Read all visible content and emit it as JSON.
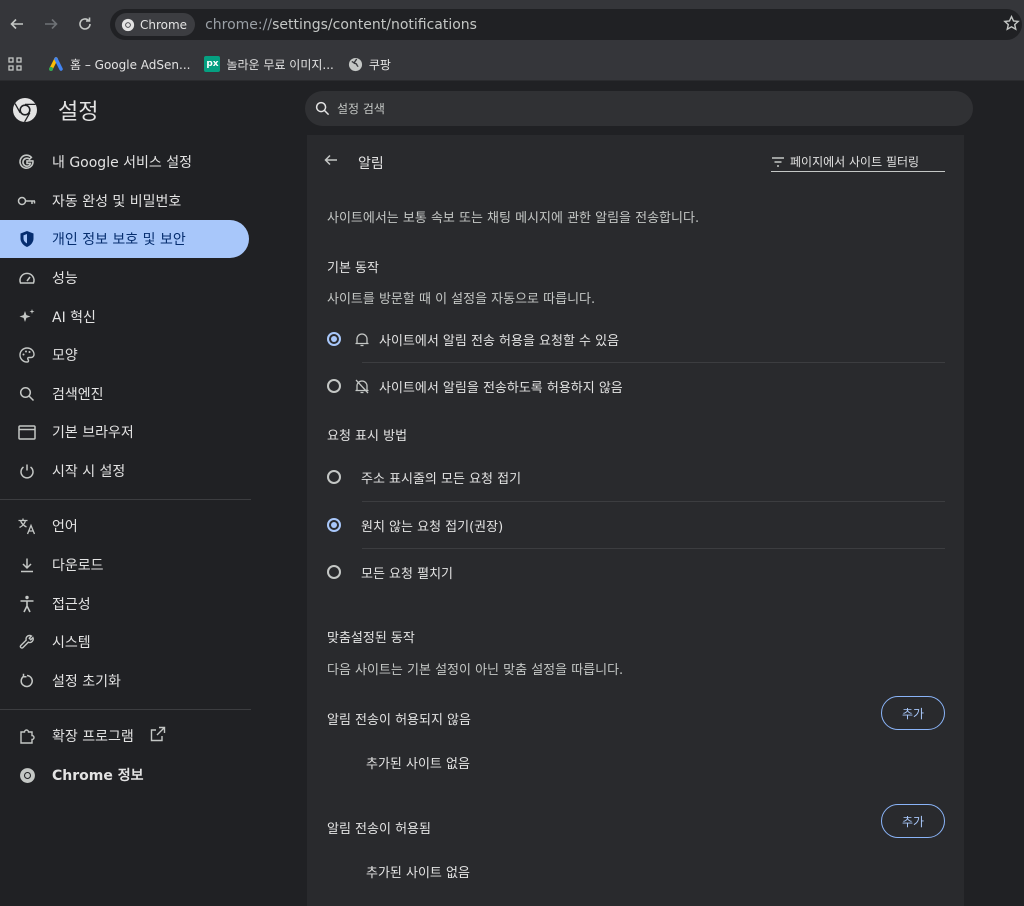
{
  "browser": {
    "chip_label": "Chrome",
    "url_scheme": "chrome://",
    "url_path": "settings/content/notifications"
  },
  "bookmarks": [
    {
      "label": "홈 – Google AdSen..."
    },
    {
      "label": "놀라운 무료 이미지..."
    },
    {
      "label": "쿠팡"
    }
  ],
  "header": {
    "title": "설정",
    "search_placeholder": "설정 검색"
  },
  "sidebar": {
    "items": [
      {
        "label": "내 Google 서비스 설정",
        "icon": "google-g-icon"
      },
      {
        "label": "자동 완성 및 비밀번호",
        "icon": "key-icon"
      },
      {
        "label": "개인 정보 보호 및 보안",
        "icon": "shield-icon",
        "active": true
      },
      {
        "label": "성능",
        "icon": "speedometer-icon"
      },
      {
        "label": "AI 혁신",
        "icon": "sparkle-icon"
      },
      {
        "label": "모양",
        "icon": "palette-icon"
      },
      {
        "label": "검색엔진",
        "icon": "search-icon"
      },
      {
        "label": "기본 브라우저",
        "icon": "browser-window-icon"
      },
      {
        "label": "시작 시 설정",
        "icon": "power-icon"
      },
      {
        "label": "언어",
        "icon": "translate-icon"
      },
      {
        "label": "다운로드",
        "icon": "download-icon"
      },
      {
        "label": "접근성",
        "icon": "accessibility-icon"
      },
      {
        "label": "시스템",
        "icon": "wrench-icon"
      },
      {
        "label": "설정 초기화",
        "icon": "reset-icon"
      },
      {
        "label": "확장 프로그램",
        "icon": "puzzle-icon"
      },
      {
        "label": "Chrome 정보",
        "icon": "chrome-logo-icon"
      }
    ]
  },
  "content": {
    "title": "알림",
    "filter_placeholder": "페이지에서 사이트 필터링",
    "description": "사이트에서는 보통 속보 또는 채팅 메시지에 관한 알림을 전송합니다.",
    "default_behavior": {
      "heading": "기본 동작",
      "sub": "사이트를 방문할 때 이 설정을 자동으로 따릅니다.",
      "options": [
        {
          "label": "사이트에서 알림 전송 허용을 요청할 수 있음",
          "selected": true,
          "icon": "bell-icon"
        },
        {
          "label": "사이트에서 알림을 전송하도록 허용하지 않음",
          "selected": false,
          "icon": "bell-off-icon"
        }
      ]
    },
    "request_display": {
      "heading": "요청 표시 방법",
      "options": [
        {
          "label": "주소 표시줄의 모든 요청 접기",
          "selected": false
        },
        {
          "label": "원치 않는 요청 접기(권장)",
          "selected": true
        },
        {
          "label": "모든 요청 펼치기",
          "selected": false
        }
      ]
    },
    "custom_behavior": {
      "heading": "맞춤설정된 동작",
      "sub": "다음 사이트는 기본 설정이 아닌 맞춤 설정을 따릅니다.",
      "blocked_heading": "알림 전송이 허용되지 않음",
      "allowed_heading": "알림 전송이 허용됨",
      "add_label": "추가",
      "empty_label": "추가된 사이트 없음"
    }
  },
  "colors": {
    "accent": "#a8c7fa",
    "background": "#202124",
    "card": "#292a2d",
    "toolbar": "#35363a"
  }
}
